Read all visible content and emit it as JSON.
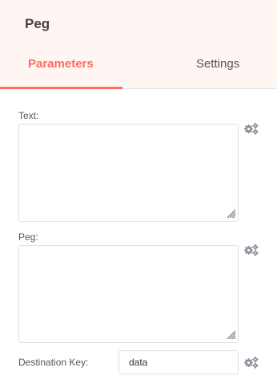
{
  "node": {
    "title": "Peg"
  },
  "tabs": {
    "parameters": "Parameters",
    "settings": "Settings"
  },
  "fields": {
    "text": {
      "label": "Text:",
      "value": ""
    },
    "peg": {
      "label": "Peg:",
      "value": ""
    },
    "destination_key": {
      "label": "Destination Key:",
      "value": "data"
    }
  },
  "icons": {
    "options": "gears-icon",
    "resize": "resize-grip-icon"
  },
  "colors": {
    "accent": "#ff6d5a",
    "header_bg": "#fff5f3",
    "border": "#dcdfe6"
  }
}
